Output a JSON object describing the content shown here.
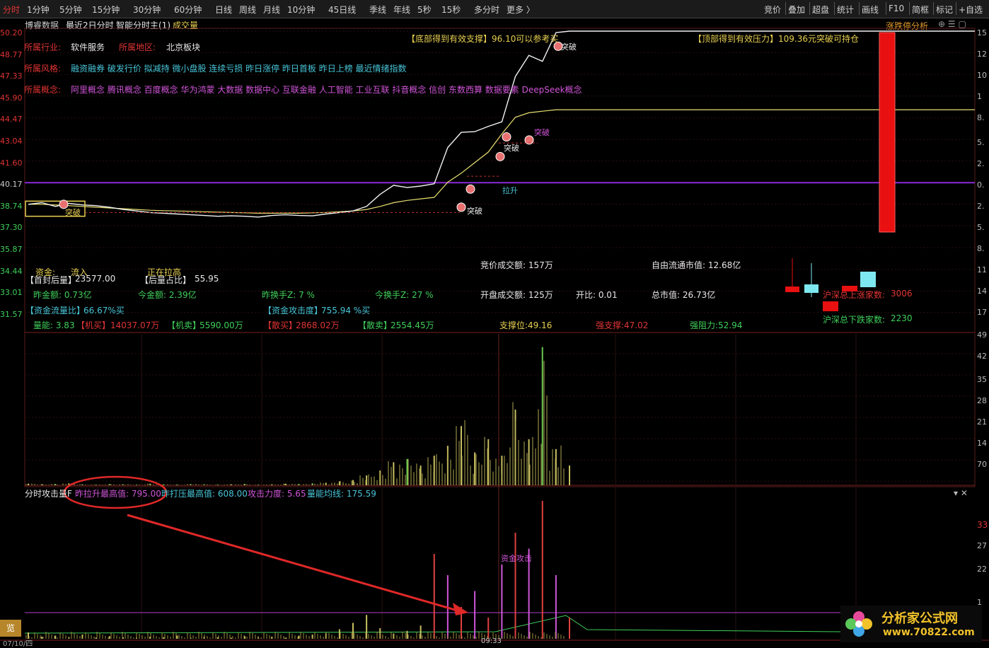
{
  "topbar": {
    "periods": [
      "分时",
      "1分钟",
      "5分钟",
      "15分钟",
      "30分钟",
      "60分钟",
      "日线",
      "周线",
      "月线",
      "10分钟",
      "45日线",
      "季线",
      "年线",
      "5秒",
      "15秒",
      "多分时",
      "更多 〉"
    ],
    "right_tools": [
      "竞价",
      "叠加",
      "超盘",
      "统计",
      "画线",
      "F10",
      "简框",
      "标记",
      "+自选"
    ]
  },
  "header": {
    "source": "博睿数据",
    "mode": "最近2日分时",
    "indicator": "智能分时主(1)",
    "volume_label": "成交量",
    "right_link": "涨跌停分析"
  },
  "info": {
    "industry_label": "所属行业:",
    "industry": "软件服务",
    "region_label": "所属地区:",
    "region": "北京板块",
    "style_label": "所属风格:",
    "styles": "融资融券 破发行价 拟减持 微小盘股 连续亏损 昨日涨停 昨日首板 昨日上榜 最近情绪指数",
    "concept_label": "所属概念:",
    "concepts": "阿里概念 腾讯概念 百度概念 华为鸿蒙 大数据 数据中心 互联金融 人工智能 工业互联 抖音概念 信创 东数西算 数据要素 DeepSeek概念"
  },
  "annotations": {
    "support_note": "【底部得到有效支撑】96.10可以参考买",
    "resist_note": "【顶部得到有效压力】109.36元突破可持仓",
    "breakout": "突破",
    "pullup": "拉升",
    "attack": "资金攻击"
  },
  "stats": {
    "zijin": "资金:",
    "liuru": "流入",
    "zhengzai": "正在拉高",
    "shoufeng_label": "【首封后量】",
    "shoufeng": "23577.00",
    "houliang_label": "【后量占比】",
    "houliang": "55.95",
    "zuojine": "昨金额: 0.73亿",
    "jinjine": "今金额: 2.39亿",
    "zuohuan": "昨换手Z: 7 %",
    "jinhuan": "今换手Z: 27 %",
    "liuliang_label": "【资金流量比】",
    "liuliang": "66.67%买",
    "gongji_label": "【资金攻击度】",
    "gongji": "755.94 %买",
    "liangneng": "量能: 3.83",
    "jimai_label": "【机买】",
    "jimai": "14037.07万",
    "jimaic_label": "【机卖】",
    "jimaic": "5590.00万",
    "sanmai_label": "【散买】",
    "sanmai": "2868.02万",
    "sanmaic_label": "【散卖】",
    "sanmaic": "2554.45万",
    "jingjia": "竞价成交额: 157万",
    "liutong": "自由流通市值: 12.68亿",
    "kaipan": "开盘成交额: 125万",
    "kaibi": "开比: 0.01",
    "zongshizhi": "总市值: 26.73亿",
    "zhicheng": "支撑位:49.16",
    "qiangzhicheng": "强支撑:47.02",
    "qiangzuli": "强阻力:52.94",
    "up_count_label": "沪深总上涨家数:",
    "up_count": "3006",
    "down_count_label": "沪深总下跌家数:",
    "down_count": "2230"
  },
  "lower": {
    "title": "分时攻击量F",
    "zuolasheng": "昨拉升最高值: 795.00",
    "zuodaya": "昨打压最高值: 608.00",
    "gongjilidu": "攻击力度: 5.65",
    "liangneng_line": "量能均线: 175.59"
  },
  "bottom": {
    "left_tab": "览",
    "date": "07/10/四",
    "time": "09:33"
  },
  "watermark": {
    "brand": "分析家公式网",
    "url": "www.70822.com"
  },
  "chart_data": {
    "type": "line",
    "title": "",
    "ylim": [
      41.57,
      50.2
    ],
    "y_ticks": [
      "50.20",
      "48.77",
      "47.33",
      "45.90",
      "44.47",
      "43.04",
      "41.60",
      "40.17",
      "38.74",
      "37.30",
      "35.87",
      "34.44",
      "33.01",
      "31.57"
    ],
    "price": [
      38.74,
      38.85,
      38.6,
      38.8,
      38.7,
      38.65,
      38.55,
      38.4,
      38.3,
      38.2,
      38.15,
      38.1,
      38.05,
      38.0,
      37.95,
      37.98,
      37.95,
      37.9,
      38.0,
      38.05,
      38.0,
      37.98,
      38.1,
      38.2,
      38.3,
      38.6,
      39.4,
      40.0,
      39.85,
      39.95,
      40.1,
      42.5,
      43.5,
      43.55,
      43.9,
      44.2,
      47.2,
      48.6,
      48.2,
      50.1,
      50.2
    ],
    "avg": [
      38.74,
      38.74,
      38.7,
      38.65,
      38.6,
      38.55,
      38.5,
      38.45,
      38.4,
      38.35,
      38.32,
      38.3,
      38.28,
      38.25,
      38.22,
      38.2,
      38.18,
      38.15,
      38.15,
      38.15,
      38.15,
      38.18,
      38.2,
      38.25,
      38.3,
      38.4,
      38.6,
      38.85,
      39.0,
      39.1,
      39.2,
      40.2,
      40.8,
      41.5,
      42.2,
      43.4,
      44.5,
      44.8,
      44.9,
      45.0,
      45.0
    ],
    "prev_close": 40.17,
    "volume": [
      5,
      3,
      4,
      6,
      3,
      2,
      4,
      3,
      2,
      5,
      3,
      2,
      4,
      3,
      2,
      3,
      4,
      2,
      3,
      5,
      4,
      6,
      8,
      12,
      16,
      30,
      45,
      70,
      80,
      60,
      90,
      120,
      180,
      100,
      140,
      90,
      230,
      140,
      420,
      110,
      60
    ],
    "attack": [
      12,
      4,
      6,
      3,
      8,
      2,
      5,
      3,
      2,
      4,
      3,
      6,
      2,
      4,
      3,
      2,
      5,
      3,
      4,
      2,
      6,
      8,
      10,
      18,
      30,
      45,
      20,
      10,
      15,
      25,
      160,
      120,
      60,
      90,
      40,
      140,
      200,
      170,
      260,
      120,
      40
    ]
  }
}
